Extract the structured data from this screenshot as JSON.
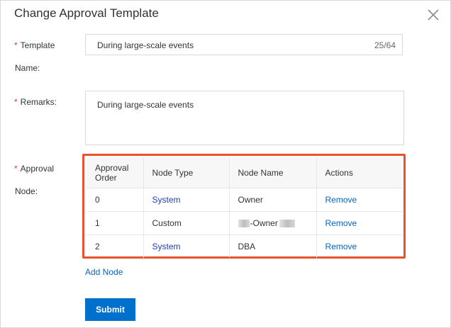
{
  "dialog": {
    "title": "Change Approval Template",
    "close_icon": "close-icon"
  },
  "form": {
    "template_name": {
      "required_mark": "*",
      "label_line1": "Template",
      "label_line2": "Name:",
      "value": "During large-scale events",
      "counter": "25/64"
    },
    "remarks": {
      "required_mark": "*",
      "label": "Remarks:",
      "value": "During large-scale events"
    },
    "approval_node": {
      "required_mark": "*",
      "label_line1": "Approval",
      "label_line2": "Node:"
    }
  },
  "table": {
    "headers": {
      "order_line1": "Approval",
      "order_line2": "Order",
      "node_type": "Node Type",
      "node_name": "Node Name",
      "actions": "Actions"
    },
    "rows": [
      {
        "order": "0",
        "node_type": "System",
        "node_name": "Owner",
        "action": "Remove"
      },
      {
        "order": "1",
        "node_type": "Custom",
        "node_name": "-Owner",
        "action": "Remove"
      },
      {
        "order": "2",
        "node_type": "System",
        "node_name": "DBA",
        "action": "Remove"
      }
    ]
  },
  "actions": {
    "add_node": "Add Node",
    "submit": "Submit"
  },
  "colors": {
    "highlight_border": "#e8532e",
    "link": "#0064c8",
    "primary_button": "#0070cc",
    "required": "#e4393c"
  }
}
